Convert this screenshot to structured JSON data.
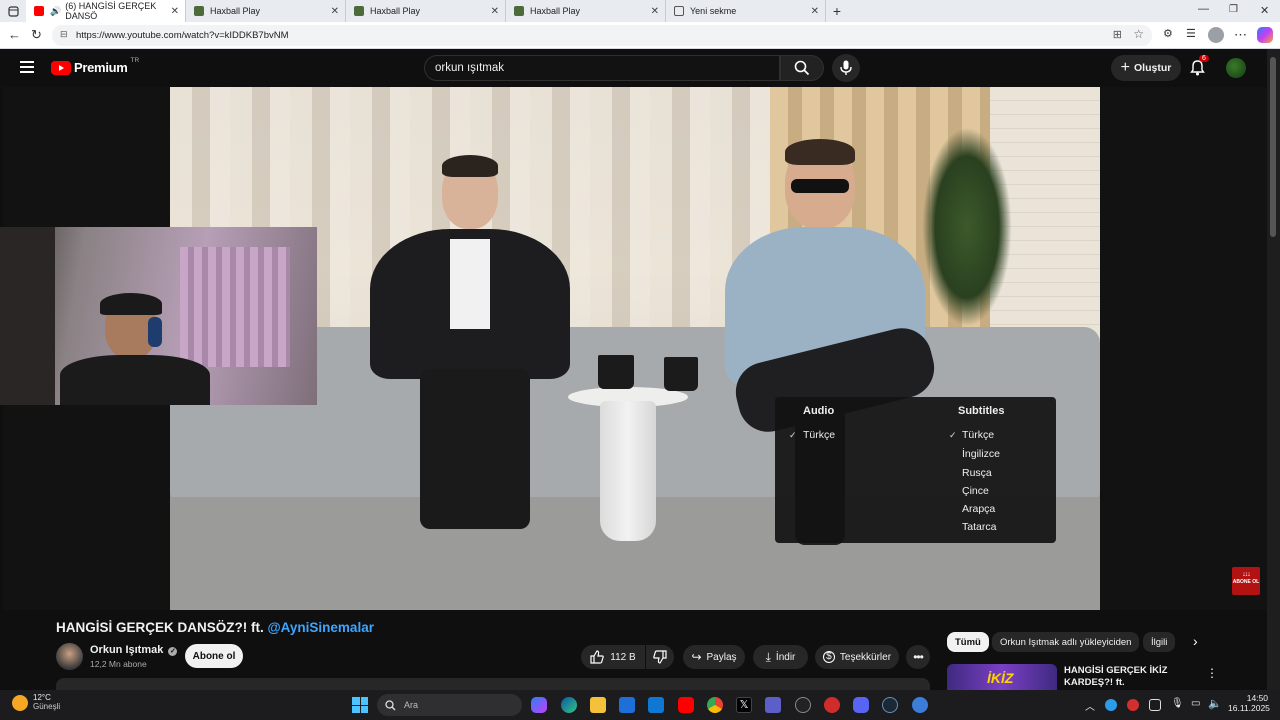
{
  "browser": {
    "tabs": [
      {
        "label": "(6) HANGİSİ GERÇEK DANSÖ",
        "active": true
      },
      {
        "label": "Haxball Play",
        "active": false
      },
      {
        "label": "Haxball Play",
        "active": false
      },
      {
        "label": "Haxball Play",
        "active": false
      },
      {
        "label": "Yeni sekme",
        "active": false
      }
    ],
    "url": "https://www.youtube.com/watch?v=kIDDKB7bvNM"
  },
  "youtube": {
    "logo_text": "Premium",
    "logo_region": "TR",
    "search_value": "orkun ışıtmak",
    "create_label": "Oluştur",
    "notification_count": "6"
  },
  "player": {
    "settings": {
      "audio_header": "Audio",
      "subtitles_header": "Subtitles",
      "audio_options": [
        "Türkçe"
      ],
      "subtitle_options": [
        "Türkçe",
        "İngilizce",
        "Rusça",
        "Çince",
        "Arapça",
        "Tatarca"
      ],
      "selected_audio": "Türkçe",
      "selected_subtitle": "Türkçe"
    },
    "watermark": "ABONE OL"
  },
  "video": {
    "title_prefix": "HANGİSİ GERÇEK DANSÖZ?! ft. ",
    "title_link": "@AyniSinemalar",
    "channel_name": "Orkun Işıtmak",
    "subscribers": "12,2 Mn abone",
    "subscribe_label": "Abone ol",
    "likes": "112 B",
    "share_label": "Paylaş",
    "download_label": "İndir",
    "thanks_label": "Teşekkürler"
  },
  "sidebar": {
    "chips": [
      "Tümü",
      "Orkun Işıtmak adlı yükleyiciden",
      "İlgili"
    ],
    "rec_title": "HANGİSİ GERÇEK İKİZ KARDEŞ?! ft.",
    "thumb_text": "İKİZ"
  },
  "taskbar": {
    "weather_temp": "12°C",
    "weather_desc": "Güneşli",
    "search_placeholder": "Ara",
    "time": "14:50",
    "date": "16.11.2025"
  },
  "colors": {
    "yt_red": "#ff0000",
    "link_blue": "#3ea6ff",
    "dark_bg": "#0f0f0f"
  }
}
